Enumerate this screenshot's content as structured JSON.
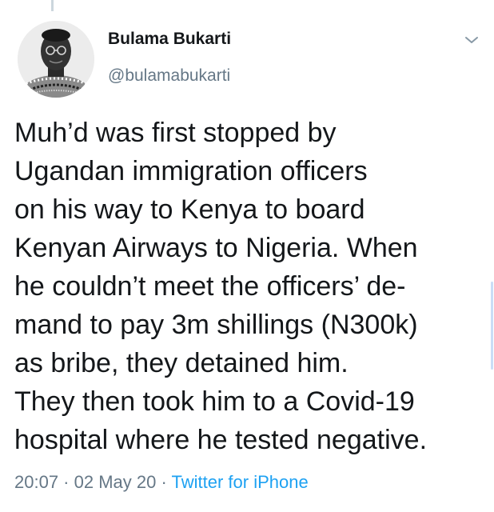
{
  "tweet": {
    "author": {
      "display_name": "Bulama Bukarti",
      "handle": "@bulamabukarti",
      "avatar_icon": "profile-photo"
    },
    "menu_icon": "chevron-down-icon",
    "text_lines": [
      "Muh’d was first stopped by",
      "Ugandan immigration officers",
      "on his way to Kenya to board",
      "Kenyan Airways to Nigeria. When",
      "he couldn’t meet the officers’ de-",
      "mand to pay 3m shillings (N300k)",
      "as bribe, they detained him.",
      "They then took him to a Covid-19",
      "hospital where he tested negative."
    ],
    "meta": {
      "time": "20:07",
      "separator": " · ",
      "date": "02 May 20",
      "source": "Twitter for iPhone"
    }
  },
  "colors": {
    "text": "#14171a",
    "secondary": "#657786",
    "link": "#1da1f2"
  }
}
